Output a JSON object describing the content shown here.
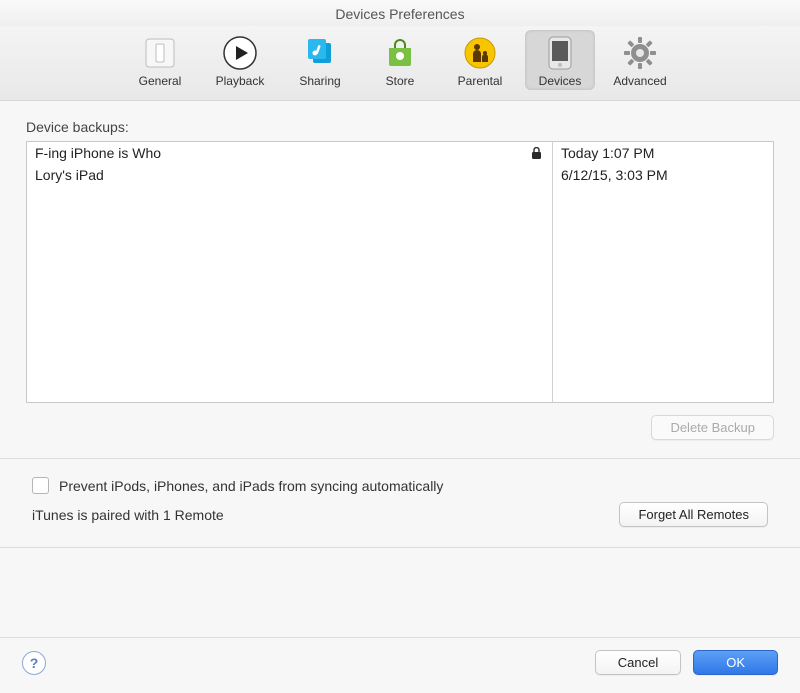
{
  "window": {
    "title": "Devices Preferences"
  },
  "tabs": [
    {
      "id": "general",
      "label": "General"
    },
    {
      "id": "playback",
      "label": "Playback"
    },
    {
      "id": "sharing",
      "label": "Sharing"
    },
    {
      "id": "store",
      "label": "Store"
    },
    {
      "id": "parental",
      "label": "Parental"
    },
    {
      "id": "devices",
      "label": "Devices",
      "active": true
    },
    {
      "id": "advanced",
      "label": "Advanced"
    }
  ],
  "backups": {
    "label": "Device backups:",
    "items": [
      {
        "name": "F-ing iPhone is Who",
        "date": "Today 1:07 PM",
        "locked": true
      },
      {
        "name": "Lory's iPad",
        "date": "6/12/15, 3:03 PM",
        "locked": false
      }
    ]
  },
  "buttons": {
    "delete_backup": "Delete Backup",
    "forget_remotes": "Forget All Remotes",
    "cancel": "Cancel",
    "ok": "OK"
  },
  "options": {
    "prevent_sync_label": "Prevent iPods, iPhones, and iPads from syncing automatically",
    "prevent_sync_checked": false,
    "remotes_status": "iTunes is paired with 1 Remote"
  }
}
